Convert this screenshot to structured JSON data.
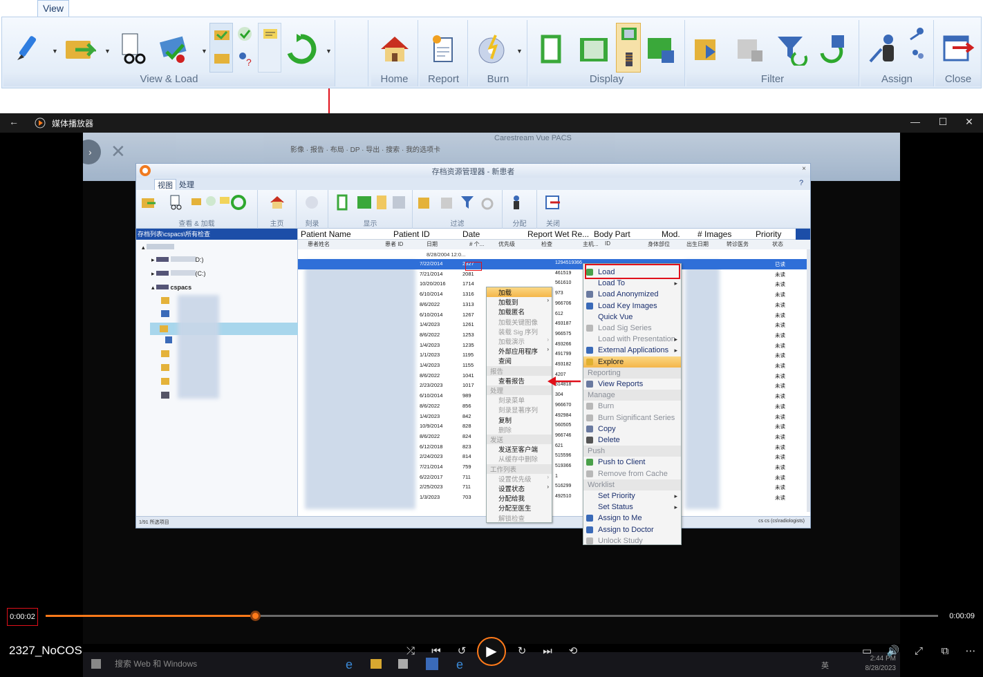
{
  "ribbon": {
    "tab": "View",
    "groups": [
      "View & Load",
      "Home",
      "Report",
      "Burn",
      "Display",
      "Filter",
      "Assign",
      "Close"
    ]
  },
  "player": {
    "app_name": "媒体播放器",
    "title": "2327_NoCOS",
    "current_time": "0:00:02",
    "duration": "0:00:09",
    "progress": 0.235
  },
  "pacs": {
    "window_title": "Carestream Vue PACS",
    "menu_items": [
      "影像",
      "报告",
      "布局",
      "DP",
      "导出",
      "搜索",
      "我的选项卡"
    ],
    "dialog_title": "存档资源管理器 - 新患者",
    "tabs": [
      "视图",
      "处理"
    ],
    "ribbon_groups": [
      "查看 & 加载",
      "主页",
      "刻录",
      "显示",
      "过滤",
      "分配",
      "关闭"
    ],
    "tree_header": "存档列表\\cspacs\\所有检查",
    "tree_items": [
      "D:)",
      "(C:)",
      "cspacs"
    ],
    "status_left": "1/91 所选项目",
    "status_right": "cs cs (cs\\radiologists)"
  },
  "grid": {
    "columns": [
      "Patient Name",
      "Patient ID",
      "Date",
      "Report Wet Re...",
      "Body Part",
      "Mod.",
      "# Images",
      "Priority"
    ],
    "sub_columns": [
      "患者姓名",
      "患者 ID",
      "日期",
      "# 个...",
      "优先级",
      "检查",
      "主机...",
      "ID",
      "身体部位",
      "出生日期",
      "转诊医务",
      "状态"
    ],
    "first_row": "8/28/2004 12:0...",
    "rows": [
      {
        "date": "7/22/2014",
        "num": "2327",
        "code": "1294519366",
        "status": "已读"
      },
      {
        "date": "7/21/2014",
        "num": "2081",
        "code": "461519",
        "status": "未读"
      },
      {
        "date": "10/20/2016",
        "num": "1714",
        "code": "561610",
        "status": "未读"
      },
      {
        "date": "6/10/2014",
        "num": "1316",
        "code": "973",
        "status": "未读"
      },
      {
        "date": "8/6/2022",
        "num": "1313",
        "code": "966706",
        "status": "未读"
      },
      {
        "date": "6/10/2014",
        "num": "1267",
        "code": "612",
        "status": "未读"
      },
      {
        "date": "1/4/2023",
        "num": "1261",
        "code": "493187",
        "status": "未读"
      },
      {
        "date": "8/6/2022",
        "num": "1253",
        "code": "966575",
        "status": "未读"
      },
      {
        "date": "1/4/2023",
        "num": "1235",
        "code": "493266",
        "status": "未读"
      },
      {
        "date": "1/1/2023",
        "num": "1195",
        "code": "491799",
        "status": "未读"
      },
      {
        "date": "1/4/2023",
        "num": "1155",
        "code": "493182",
        "status": "未读"
      },
      {
        "date": "8/6/2022",
        "num": "1041",
        "code": "4207",
        "status": "未读"
      },
      {
        "date": "2/23/2023",
        "num": "1017",
        "code": "514818",
        "status": "未读"
      },
      {
        "date": "6/10/2014",
        "num": "989",
        "code": "304",
        "status": "未读"
      },
      {
        "date": "8/6/2022",
        "num": "856",
        "code": "966670",
        "status": "未读"
      },
      {
        "date": "1/4/2023",
        "num": "842",
        "code": "492984",
        "status": "未读"
      },
      {
        "date": "10/9/2014",
        "num": "828",
        "code": "560505",
        "status": "未读"
      },
      {
        "date": "8/6/2022",
        "num": "824",
        "code": "966746",
        "status": "未读"
      },
      {
        "date": "6/12/2018",
        "num": "823",
        "code": "621",
        "status": "未读"
      },
      {
        "date": "2/24/2023",
        "num": "814",
        "code": "515596",
        "status": "未读"
      },
      {
        "date": "7/21/2014",
        "num": "759",
        "code": "519366",
        "status": "未读"
      },
      {
        "date": "6/22/2017",
        "num": "711",
        "code": "1",
        "status": "未读"
      },
      {
        "date": "2/25/2023",
        "num": "711",
        "code": "516299",
        "status": "未读"
      },
      {
        "date": "1/3/2023",
        "num": "703",
        "code": "492510",
        "status": "未读"
      }
    ]
  },
  "menu_cn": [
    {
      "label": "加载",
      "type": "hl"
    },
    {
      "label": "加载到",
      "type": "item",
      "arrow": true
    },
    {
      "label": "加载匿名",
      "type": "item"
    },
    {
      "label": "加载关键图像",
      "type": "dis"
    },
    {
      "label": "装载 Sig 序列",
      "type": "dis"
    },
    {
      "label": "加载演示",
      "type": "dis",
      "arrow": true
    },
    {
      "label": "外部应用程序",
      "type": "item",
      "arrow": true
    },
    {
      "label": "查阅",
      "type": "item"
    },
    {
      "label": "报告",
      "type": "hdr"
    },
    {
      "label": "查看报告",
      "type": "item"
    },
    {
      "label": "处理",
      "type": "hdr"
    },
    {
      "label": "刻录菜单",
      "type": "dis"
    },
    {
      "label": "刻录显著序列",
      "type": "dis"
    },
    {
      "label": "复制",
      "type": "item"
    },
    {
      "label": "删除",
      "type": "dis"
    },
    {
      "label": "发送",
      "type": "hdr"
    },
    {
      "label": "发送至客户端",
      "type": "item"
    },
    {
      "label": "从缓存中删除",
      "type": "dis"
    },
    {
      "label": "工作列表",
      "type": "hdr"
    },
    {
      "label": "设置优先级",
      "type": "dis",
      "arrow": true
    },
    {
      "label": "设置状态",
      "type": "item",
      "arrow": true
    },
    {
      "label": "分配给我",
      "type": "item"
    },
    {
      "label": "分配至医生",
      "type": "item"
    },
    {
      "label": "解锁检查",
      "type": "dis"
    }
  ],
  "menu_en": [
    {
      "label": "Load",
      "type": "item",
      "icon": "#4aa04a"
    },
    {
      "label": "Load To",
      "type": "item",
      "arrow": true
    },
    {
      "label": "Load Anonymized",
      "type": "item",
      "icon": "#6a7aa0"
    },
    {
      "label": "Load Key Images",
      "type": "item",
      "icon": "#3a6ab8"
    },
    {
      "label": "Quick Vue",
      "type": "item"
    },
    {
      "label": "Load Sig Series",
      "type": "dis",
      "icon": "#b8b8b8"
    },
    {
      "label": "Load with Presentation",
      "type": "dis",
      "arrow": true
    },
    {
      "label": "External Applications",
      "type": "item",
      "arrow": true,
      "icon": "#3a6ab8"
    },
    {
      "label": "Explore",
      "type": "hl",
      "icon": "#e0b030"
    },
    {
      "label": "Reporting",
      "type": "hdr"
    },
    {
      "label": "View Reports",
      "type": "item",
      "icon": "#6a7aa0"
    },
    {
      "label": "Manage",
      "type": "hdr"
    },
    {
      "label": "Burn",
      "type": "dis",
      "icon": "#b8b8b8"
    },
    {
      "label": "Burn Significant Series",
      "type": "dis",
      "icon": "#b8b8b8"
    },
    {
      "label": "Copy",
      "type": "item",
      "icon": "#6a7aa0"
    },
    {
      "label": "Delete",
      "type": "item",
      "icon": "#555"
    },
    {
      "label": "Push",
      "type": "hdr"
    },
    {
      "label": "Push to Client",
      "type": "item",
      "icon": "#4aa04a"
    },
    {
      "label": "Remove from Cache",
      "type": "dis",
      "icon": "#b8b8b8"
    },
    {
      "label": "Worklist",
      "type": "hdr"
    },
    {
      "label": "Set Priority",
      "type": "item",
      "arrow": true
    },
    {
      "label": "Set Status",
      "type": "item",
      "arrow": true
    },
    {
      "label": "Assign to Me",
      "type": "item",
      "icon": "#3a6ab8"
    },
    {
      "label": "Assign to Doctor",
      "type": "item",
      "icon": "#3a6ab8"
    },
    {
      "label": "Unlock Study",
      "type": "dis",
      "icon": "#b8b8b8"
    }
  ],
  "taskbar": {
    "search_placeholder": "搜索 Web 和 Windows",
    "time": "2:44 PM",
    "date": "8/28/2023",
    "lang": "英"
  },
  "colors": {
    "accent_orange": "#ff7a1a",
    "annotation_red": "#e0101a",
    "selection_blue": "#1c4ea8"
  }
}
